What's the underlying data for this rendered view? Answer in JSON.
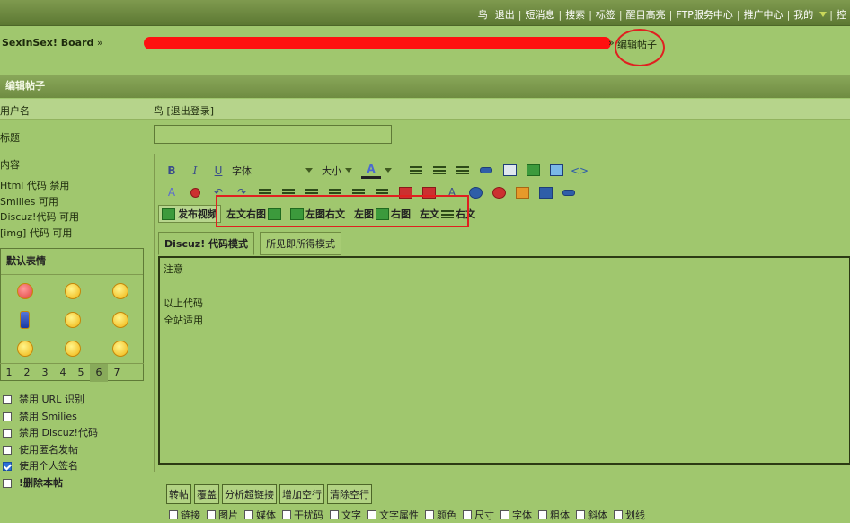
{
  "topnav": {
    "items": [
      "鸟",
      "退出",
      "短消息",
      "搜索",
      "标签",
      "醒目高亮",
      "FTP服务中心",
      "推广中心",
      "我的",
      "控"
    ]
  },
  "breadcrumb": {
    "site": "SexInSex! Board",
    "separator": "»",
    "current": "编辑帖子"
  },
  "section": {
    "title": "编辑帖子"
  },
  "form": {
    "username_label": "用户名",
    "username_value": "鸟 [退出登录]",
    "title_label": "标题",
    "title_value": "",
    "content_label": "内容",
    "info": [
      "Html 代码 禁用",
      "Smilies 可用",
      "Discuz!代码 可用",
      "[img] 代码 可用"
    ]
  },
  "smilies": {
    "title": "默认表情",
    "pages": [
      "1",
      "2",
      "3",
      "4",
      "5",
      "6",
      "7"
    ],
    "active_page": "6",
    "icons": [
      "angry-face-icon",
      "smile-icon",
      "shy-face-icon",
      "blue-figure-icon",
      "tongue-face-icon",
      "laugh-face-icon",
      "grin-icon",
      "happy-face-icon",
      "cry-face-icon"
    ]
  },
  "options": [
    {
      "label": "禁用 URL 识别",
      "checked": false
    },
    {
      "label": "禁用 Smilies",
      "checked": false
    },
    {
      "label": "禁用 Discuz!代码",
      "checked": false
    },
    {
      "label": "使用匿名发帖",
      "checked": false
    },
    {
      "label": "使用个人签名",
      "checked": true
    },
    {
      "label": "!删除本帖",
      "checked": false
    }
  ],
  "editor": {
    "font_label": "字体",
    "size_label": "大小",
    "publish_video": "发布视频",
    "layouts": [
      "左文右图",
      "左图右文",
      "左图",
      "右图",
      "左文",
      "右文"
    ],
    "mode_discuz": "Discuz! 代码模式",
    "mode_wysiwyg": "所见即所得模式",
    "content_lines": [
      "注意",
      "",
      "以上代码",
      "全站适用"
    ]
  },
  "bottom_buttons": [
    "转帖",
    "覆盖",
    "分析超链接",
    "增加空行",
    "清除空行"
  ],
  "bottom_options": [
    "链接",
    "图片",
    "媒体",
    "干扰码",
    "文字",
    "文字属性",
    "颜色",
    "尺寸",
    "字体",
    "粗体",
    "斜体",
    "划线"
  ]
}
